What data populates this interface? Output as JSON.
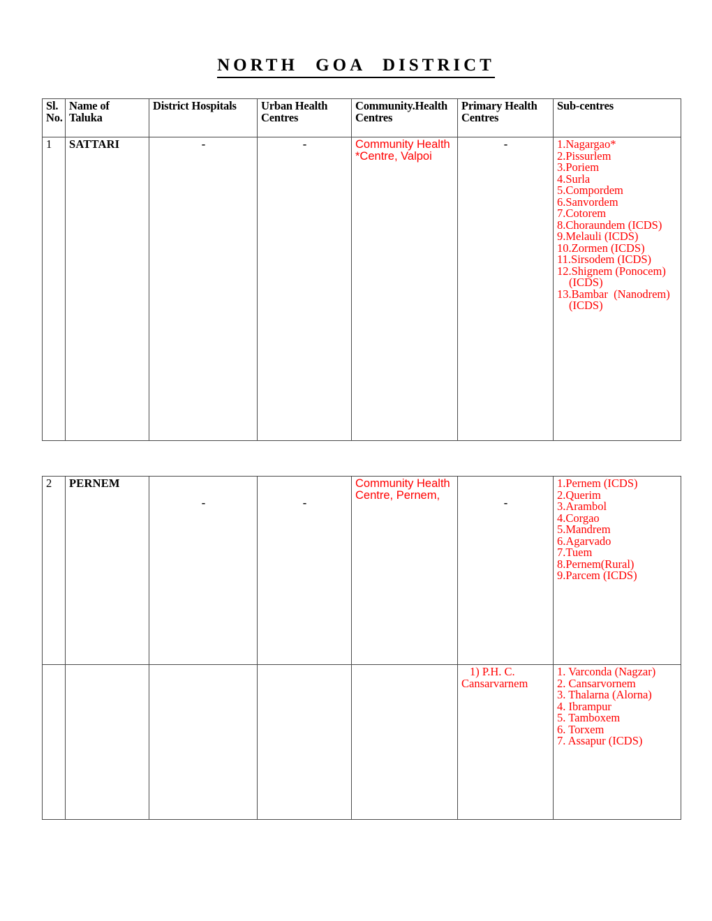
{
  "document": {
    "title": "N O R T H   G O A   D I S T R I C T",
    "title_plain": "NORTH GOA DISTRICT",
    "accent_color": "#ff0000",
    "border_color": "#4a4a4a"
  },
  "table": {
    "headers": {
      "sl_no": "Sl.\nNo.",
      "sl_no_line1": "Sl.",
      "sl_no_line2": "No.",
      "taluka_line1": "Name of",
      "taluka_line2": "Taluka",
      "district_hospitals": "District Hospitals",
      "urban_health_line1": "Urban Health",
      "urban_health_line2": "Centres",
      "community_health_line1": "Community.Health",
      "community_health_line2": "Centres",
      "primary_health_line1": "Primary Health",
      "primary_health_line2": "Centres",
      "sub_centres": "Sub-centres"
    },
    "rows": [
      {
        "sl_no": "1",
        "taluka": "SATTARI",
        "district_hospitals": "-",
        "urban_health_centres": "-",
        "community_health_centres_line1": "Community Health",
        "community_health_centres_line2": "*Centre, Valpoi",
        "primary_health_centres": "-",
        "sub_centres": [
          "1.Nagargao*",
          "2.Pissurlem",
          "3.Poriem",
          "4.Surla",
          "5.Compordem",
          "6.Sanvordem",
          "7.Cotorem",
          "8.Choraundem (ICDS)",
          "9.Melauli (ICDS)",
          "10.Zormen (ICDS)",
          "11.Sirsodem (ICDS)",
          "12.Shignem (Ponocem)",
          "(ICDS)",
          "13.Bambar  (Nanodrem)",
          "(ICDS)"
        ],
        "sub_centres_wrapped_indices": [
          12,
          14
        ]
      },
      {
        "sl_no": "2",
        "taluka": "PERNEM",
        "district_hospitals": "-",
        "urban_health_centres": "-",
        "community_health_centres_line1": "Community Health",
        "community_health_centres_line2": "Centre, Pernem,",
        "primary_health_centres": "-",
        "sub_centres": [
          "1.Pernem (ICDS)",
          "2.Querim",
          "3.Arambol",
          "4.Corgao",
          "5.Mandrem",
          "6.Agarvado",
          "7.Tuem",
          "8.Pernem(Rural)",
          "9.Parcem (ICDS)"
        ],
        "secondary_block": {
          "primary_health_centres": [
            "1)  P.H. C.",
            "Cansarvarnem"
          ],
          "sub_centres": [
            "1. Varconda (Nagzar)",
            "2. Cansarvornem",
            "3. Thalarna (Alorna)",
            "4. Ibrampur",
            "5. Tamboxem",
            "6. Torxem",
            "7. Assapur (ICDS)"
          ]
        }
      }
    ]
  }
}
